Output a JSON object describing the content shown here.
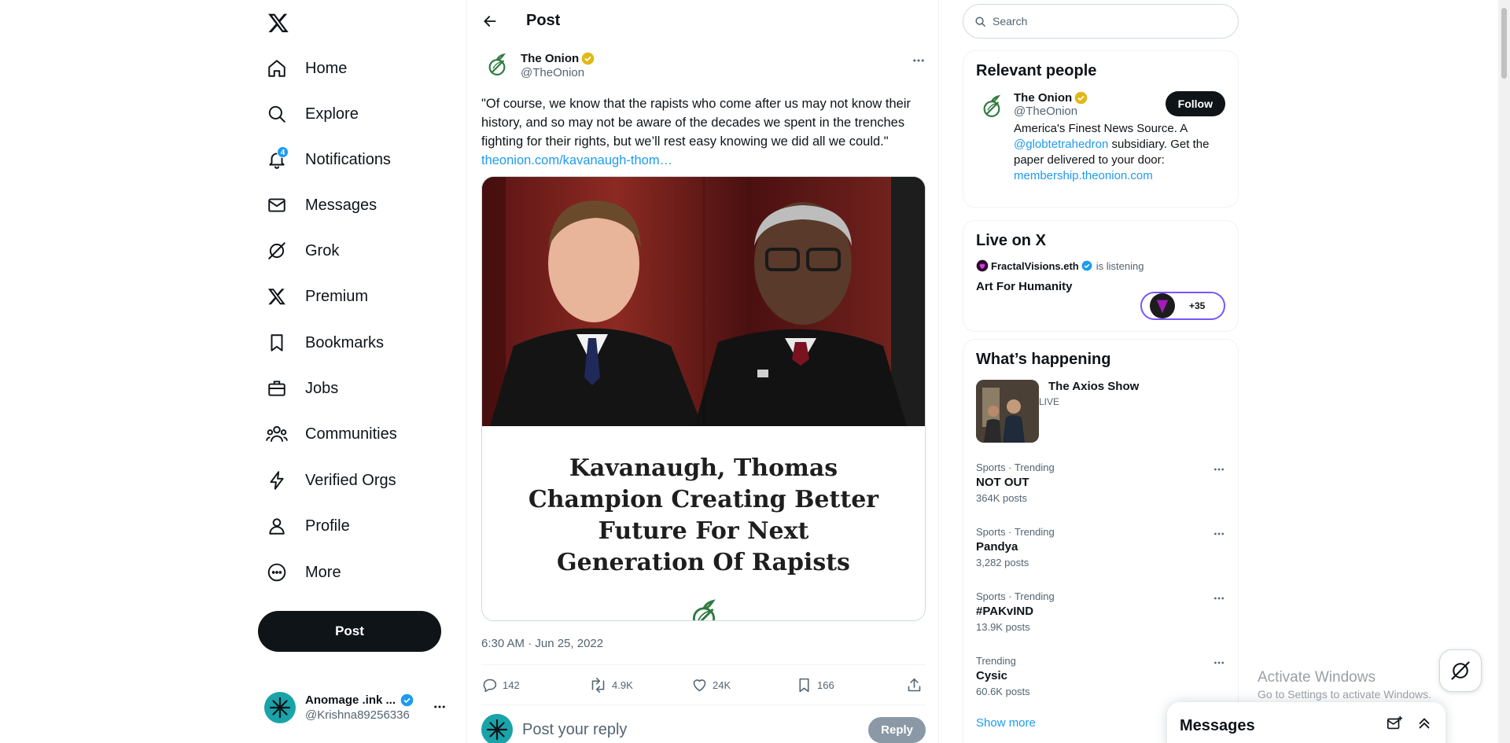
{
  "nav": {
    "logo_icon": "x-logo-icon",
    "items": [
      {
        "label": "Home",
        "icon": "home-icon"
      },
      {
        "label": "Explore",
        "icon": "search-icon"
      },
      {
        "label": "Notifications",
        "icon": "bell-icon",
        "badge": "4"
      },
      {
        "label": "Messages",
        "icon": "envelope-icon"
      },
      {
        "label": "Grok",
        "icon": "grok-icon"
      },
      {
        "label": "Premium",
        "icon": "x-logo-icon"
      },
      {
        "label": "Bookmarks",
        "icon": "bookmark-icon"
      },
      {
        "label": "Jobs",
        "icon": "briefcase-icon"
      },
      {
        "label": "Communities",
        "icon": "people-icon"
      },
      {
        "label": "Verified Orgs",
        "icon": "lightning-icon"
      },
      {
        "label": "Profile",
        "icon": "person-icon"
      },
      {
        "label": "More",
        "icon": "more-circle-icon"
      }
    ],
    "post_button": "Post",
    "account": {
      "name": "Anomage .ink ...",
      "handle": "@Krishna89256336"
    }
  },
  "main": {
    "header_title": "Post",
    "tweet": {
      "author_name": "The Onion",
      "author_handle": "@TheOnion",
      "text": "\"Of course, we know that the rapists who come after us may not know their history, and so may not be aware of the decades we spent in the trenches fighting for their rights, but we’ll rest easy knowing we did all we could.\" ",
      "link": "theonion.com/kavanaugh-thom…",
      "card_headline": "Kavanaugh, Thomas Champion Creating Better Future For Next Generation Of Rapists",
      "timestamp": "6:30 AM · Jun 25, 2022",
      "stats": {
        "replies": "142",
        "reposts": "4.9K",
        "likes": "24K",
        "bookmarks": "166"
      }
    },
    "reply": {
      "placeholder": "Post your reply",
      "button": "Reply"
    }
  },
  "sidebar": {
    "search_placeholder": "Search",
    "relevant_people": {
      "title": "Relevant people",
      "name": "The Onion",
      "handle": "@TheOnion",
      "follow_label": "Follow",
      "bio_1": "America's Finest News Source. A ",
      "bio_mention": "@globtetrahedron",
      "bio_2": " subsidiary. Get the paper delivered to your door: ",
      "bio_link": "membership.theonion.com"
    },
    "live": {
      "title": "Live on X",
      "host": "FractalVisions.eth",
      "status": "is listening",
      "space_title": "Art For Humanity",
      "listener_count": "+35"
    },
    "happening": {
      "title": "What’s happening",
      "featured": {
        "title": "The Axios Show",
        "sub": "LIVE"
      },
      "trends": [
        {
          "category": "Sports · Trending",
          "name": "NOT OUT",
          "count": "364K posts"
        },
        {
          "category": "Sports · Trending",
          "name": "Pandya",
          "count": "3,282 posts"
        },
        {
          "category": "Sports · Trending",
          "name": "#PAKvIND",
          "count": "13.9K posts"
        },
        {
          "category": "Trending",
          "name": "Cysic",
          "count": "60.6K posts"
        }
      ],
      "show_more": "Show more"
    }
  },
  "overlay": {
    "activate_title": "Activate Windows",
    "activate_sub": "Go to Settings to activate Windows.",
    "messages_title": "Messages"
  },
  "colors": {
    "accent": "#1d9bf0",
    "text": "#0f1419",
    "secondary": "#536471",
    "verified_gold": "#e2b719",
    "onion_green": "#2d7a3e"
  }
}
